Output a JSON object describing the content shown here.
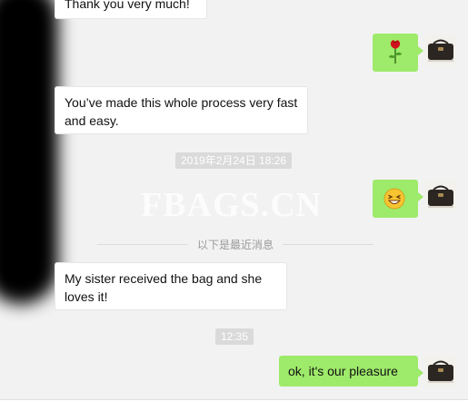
{
  "messages": [
    {
      "side": "left",
      "text": "Thank you very much!"
    },
    {
      "side": "right",
      "emoji": "rose-icon"
    },
    {
      "side": "left",
      "text": "You’ve made this whole process very fast and easy."
    },
    {
      "side": "right",
      "emoji": "grin-icon"
    },
    {
      "side": "left",
      "text": "My sister received the bag and she loves it!"
    },
    {
      "side": "right",
      "text": "ok, it's our pleasure"
    }
  ],
  "timestamps": [
    "2019年2月24日 18:26",
    "12:35"
  ],
  "divider_text": "以下是最近消息",
  "watermark": "FBAGS.CN",
  "colors": {
    "background": "#f2f2f2",
    "outgoing_bubble": "#9eea6a",
    "incoming_bubble": "#ffffff",
    "timestamp_bg": "#dadada"
  }
}
